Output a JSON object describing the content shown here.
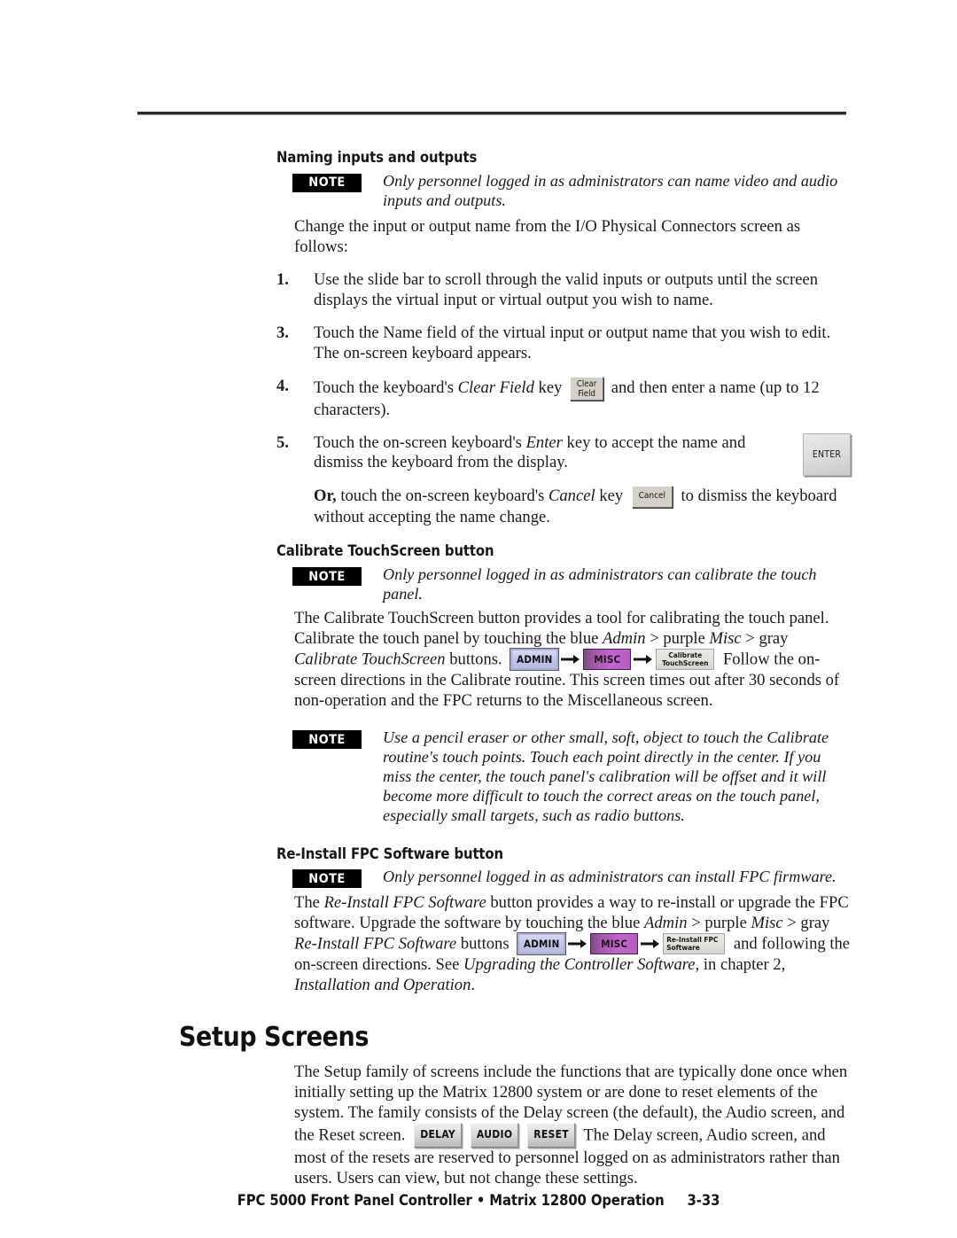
{
  "document": {
    "footer_title": "FPC 5000 Front Panel Controller • Matrix 12800 Operation",
    "page_number": "3-33"
  },
  "sections": {
    "naming": {
      "heading": "Naming inputs and outputs",
      "note_badge": "NOTE",
      "note_text": "Only personnel logged in as administrators can name video and audio inputs and outputs.",
      "intro": "Change the input or output name from the I/O Physical Connectors screen as follows:",
      "steps": [
        {
          "number": "1.",
          "text": "Use the slide bar to scroll through the valid inputs or outputs until the screen displays the virtual input or virtual output you wish to name."
        },
        {
          "number": "3.",
          "text": "Touch the Name field of the virtual input or output name that you wish to edit.  The on-screen keyboard appears."
        },
        {
          "number": "4.",
          "text_before": "Touch the keyboard's ",
          "text_italic": "Clear Field",
          "text_mid": " key ",
          "button": "Clear\nField",
          "text_after": " and then enter a name (up to 12 characters)."
        },
        {
          "number": "5.",
          "text_before": "Touch the on-screen keyboard's ",
          "text_italic": "Enter",
          "text_after": " key to accept the name and dismiss the keyboard from the display.",
          "button": "ENTER"
        }
      ],
      "or_clause": {
        "lead": "Or,",
        "text_before": " touch the on-screen keyboard's ",
        "text_italic": "Cancel",
        "text_mid": " key ",
        "button": "Cancel",
        "text_after": " to dismiss the keyboard without accepting the name change."
      }
    },
    "calibrate": {
      "heading": "Calibrate TouchScreen button",
      "note_badge": "NOTE",
      "note_text": "Only personnel logged in as administrators can calibrate the touch panel.",
      "body_1": "The Calibrate TouchScreen button provides a tool for calibrating the touch panel. Calibrate the touch panel by touching the blue ",
      "body_italic_1": "Admin",
      "body_2": " >  purple ",
      "body_italic_2": "Misc",
      "body_3": " > gray ",
      "body_italic_3": "Calibrate TouchScreen",
      "body_4": " buttons. ",
      "body_5": " Follow the on-screen directions in the Calibrate routine.  This screen times out after 30 seconds of non-operation and the FPC returns to the Miscellaneous screen.",
      "chain": {
        "admin": "ADMIN",
        "misc": "MISC",
        "target": "Calibrate\nTouchScreen"
      },
      "note2_badge": "NOTE",
      "note2_text": "Use a pencil eraser or other small, soft, object to touch the Calibrate routine's touch points.  Touch each point directly in the center.  If you miss the center, the touch panel's calibration will be offset and it will become more difficult to touch the correct areas on the touch panel, especially small targets, such as radio buttons."
    },
    "reinstall": {
      "heading": "Re-Install FPC Software button",
      "note_badge": "NOTE",
      "note_text": "Only personnel logged in as administrators can install FPC firmware.",
      "body_1": "The ",
      "body_italic_1": "Re-Install FPC Software",
      "body_2": " button provides a way to re-install or upgrade the FPC software.  Upgrade the software by touching the blue ",
      "body_italic_2": "Admin",
      "body_3": " >  purple ",
      "body_italic_3": "Misc",
      "body_4": " > gray ",
      "body_italic_4": "Re-Install FPC Software",
      "body_5": " buttons ",
      "body_6": " and following the on-screen directions.  See ",
      "body_italic_5": "Upgrading the Controller Software",
      "body_7": ", in chapter 2, ",
      "body_italic_6": "Installation and Operation",
      "body_8": ".",
      "chain": {
        "admin": "ADMIN",
        "misc": "MISC",
        "target": "Re-Install FPC\nSoftware"
      }
    },
    "setup": {
      "heading": "Setup Screens",
      "body_1": "The Setup family of screens include the functions that are typically done once when initially setting up the Matrix 12800 system or are done to reset elements of the system.  The family consists of the Delay screen (the default), the Audio screen, and the Reset screen. ",
      "body_2": " The Delay screen, Audio screen, and most of the resets are reserved to personnel logged on as administrators rather than users.  Users can view, but not change these settings.",
      "buttons": {
        "delay": "DELAY",
        "audio": "AUDIO",
        "reset": "RESET"
      }
    }
  },
  "colors": {
    "note_badge_bg": "#000000",
    "admin_button": "#c3c6e6",
    "misc_button": "#c266cc",
    "gray_button": "#e0e0dc",
    "text": "#1b1b1b"
  }
}
